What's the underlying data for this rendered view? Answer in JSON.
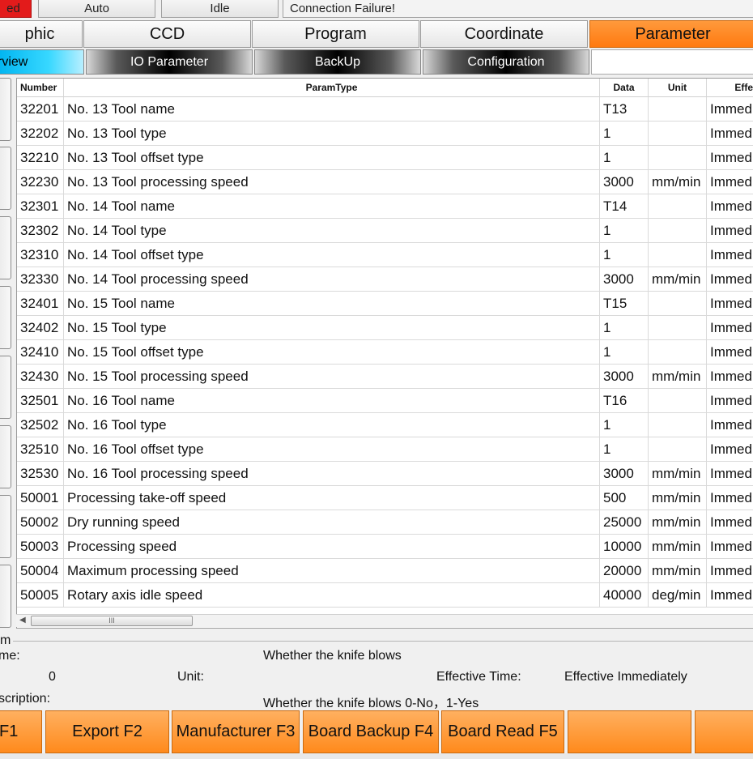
{
  "status_bar": {
    "mode_state": "ed",
    "run_mode": "Auto",
    "machine_state": "Idle",
    "message": "Connection Failure!",
    "colors": {
      "error": "#e31b1b"
    }
  },
  "main_tabs": [
    {
      "label": "phic"
    },
    {
      "label": "CCD"
    },
    {
      "label": "Program"
    },
    {
      "label": "Coordinate"
    },
    {
      "label": "Parameter"
    }
  ],
  "active_main_tab": "Parameter",
  "sub_tabs": [
    {
      "label": "rview"
    },
    {
      "label": "IO Parameter"
    },
    {
      "label": "BackUp"
    },
    {
      "label": "Configuration"
    }
  ],
  "table": {
    "headers": {
      "number": "Number",
      "param_type": "ParamType",
      "data": "Data",
      "unit": "Unit",
      "effective": "Effe"
    },
    "rows": [
      {
        "number": "32201",
        "param_type": "No. 13 Tool name",
        "data": "T13",
        "unit": "",
        "effective": "Immed"
      },
      {
        "number": "32202",
        "param_type": "No. 13 Tool type",
        "data": "1",
        "unit": "",
        "effective": "Immed"
      },
      {
        "number": "32210",
        "param_type": "No. 13 Tool offset type",
        "data": "1",
        "unit": "",
        "effective": "Immed"
      },
      {
        "number": "32230",
        "param_type": "No. 13 Tool processing speed",
        "data": "3000",
        "unit": "mm/min",
        "effective": "Immed"
      },
      {
        "number": "32301",
        "param_type": "No. 14 Tool name",
        "data": "T14",
        "unit": "",
        "effective": "Immed"
      },
      {
        "number": "32302",
        "param_type": "No. 14 Tool type",
        "data": "1",
        "unit": "",
        "effective": "Immed"
      },
      {
        "number": "32310",
        "param_type": "No. 14 Tool offset type",
        "data": "1",
        "unit": "",
        "effective": "Immed"
      },
      {
        "number": "32330",
        "param_type": "No. 14 Tool processing speed",
        "data": "3000",
        "unit": "mm/min",
        "effective": "Immed"
      },
      {
        "number": "32401",
        "param_type": "No. 15 Tool name",
        "data": "T15",
        "unit": "",
        "effective": "Immed"
      },
      {
        "number": "32402",
        "param_type": "No. 15 Tool type",
        "data": "1",
        "unit": "",
        "effective": "Immed"
      },
      {
        "number": "32410",
        "param_type": "No. 15 Tool offset type",
        "data": "1",
        "unit": "",
        "effective": "Immed"
      },
      {
        "number": "32430",
        "param_type": "No. 15 Tool processing speed",
        "data": "3000",
        "unit": "mm/min",
        "effective": "Immed"
      },
      {
        "number": "32501",
        "param_type": "No. 16 Tool name",
        "data": "T16",
        "unit": "",
        "effective": "Immed"
      },
      {
        "number": "32502",
        "param_type": "No. 16 Tool type",
        "data": "1",
        "unit": "",
        "effective": "Immed"
      },
      {
        "number": "32510",
        "param_type": "No. 16 Tool offset type",
        "data": "1",
        "unit": "",
        "effective": "Immed"
      },
      {
        "number": "32530",
        "param_type": "No. 16 Tool processing speed",
        "data": "3000",
        "unit": "mm/min",
        "effective": "Immed"
      },
      {
        "number": "50001",
        "param_type": "Processing take-off speed",
        "data": "500",
        "unit": "mm/min",
        "effective": "Immed"
      },
      {
        "number": "50002",
        "param_type": "Dry running speed",
        "data": "25000",
        "unit": "mm/min",
        "effective": "Immed"
      },
      {
        "number": "50003",
        "param_type": "Processing speed",
        "data": "10000",
        "unit": "mm/min",
        "effective": "Immed"
      },
      {
        "number": "50004",
        "param_type": "Maximum processing speed",
        "data": "20000",
        "unit": "mm/min",
        "effective": "Immed"
      },
      {
        "number": "50005",
        "param_type": "Rotary axis idle speed",
        "data": "40000",
        "unit": "deg/min",
        "effective": "Immed"
      }
    ],
    "scrollbar_thumb_glyph": "III"
  },
  "detail": {
    "group_label": "m",
    "name_label": "me:",
    "name_value": "Whether the knife blows",
    "value": "0",
    "unit_label": "Unit:",
    "effective_time_label": "Effective Time:",
    "effective_time_value": "Effective Immediately",
    "description_label": "scription:",
    "description_value": "Whether the knife blows 0-No，1-Yes"
  },
  "function_keys": [
    {
      "label": "F1"
    },
    {
      "label": "Export F2"
    },
    {
      "label": "Manufacturer F3"
    },
    {
      "label": "Board Backup F4"
    },
    {
      "label": "Board Read F5"
    },
    {
      "label": ""
    },
    {
      "label": ""
    }
  ]
}
